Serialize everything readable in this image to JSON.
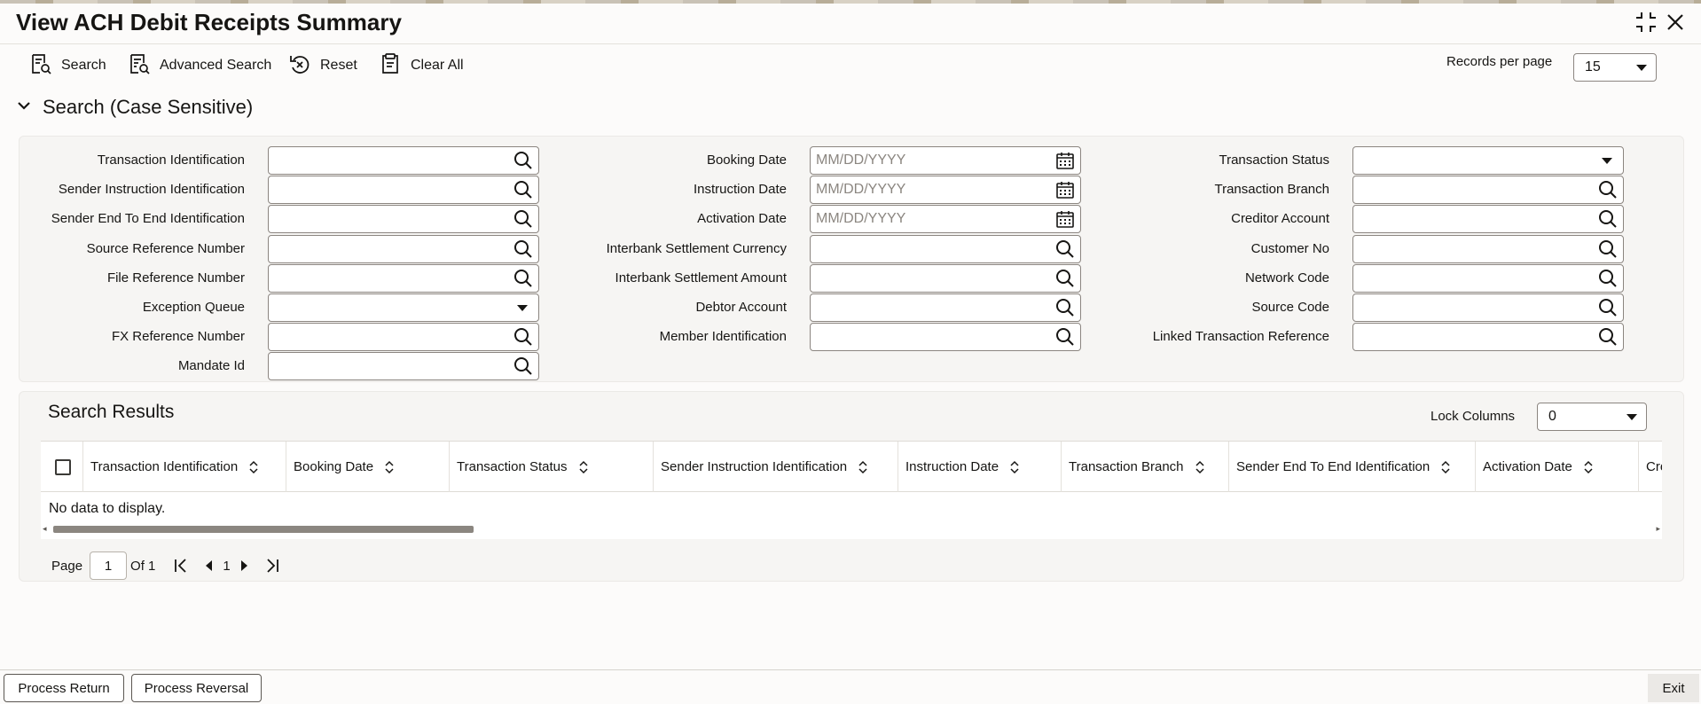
{
  "window": {
    "title": "View ACH Debit Receipts Summary"
  },
  "toolbar": {
    "search_label": "Search",
    "advanced_search_label": "Advanced Search",
    "reset_label": "Reset",
    "clear_all_label": "Clear All",
    "records_per_page_label": "Records per page",
    "records_per_page_value": "15"
  },
  "search_section": {
    "title": "Search (Case Sensitive)",
    "date_placeholder": "MM/DD/YYYY",
    "col1": [
      {
        "label": "Transaction Identification",
        "type": "lookup"
      },
      {
        "label": "Sender Instruction Identification",
        "type": "lookup"
      },
      {
        "label": "Sender End To End Identification",
        "type": "lookup"
      },
      {
        "label": "Source Reference Number",
        "type": "lookup"
      },
      {
        "label": "File Reference Number",
        "type": "lookup"
      },
      {
        "label": "Exception Queue",
        "type": "select"
      },
      {
        "label": "FX Reference Number",
        "type": "lookup"
      },
      {
        "label": "Mandate Id",
        "type": "lookup"
      }
    ],
    "col2": [
      {
        "label": "Booking Date",
        "type": "date"
      },
      {
        "label": "Instruction Date",
        "type": "date"
      },
      {
        "label": "Activation Date",
        "type": "date"
      },
      {
        "label": "Interbank Settlement Currency",
        "type": "lookup"
      },
      {
        "label": "Interbank Settlement Amount",
        "type": "lookup"
      },
      {
        "label": "Debtor Account",
        "type": "lookup"
      },
      {
        "label": "Member Identification",
        "type": "lookup"
      }
    ],
    "col3": [
      {
        "label": "Transaction Status",
        "type": "select"
      },
      {
        "label": "Transaction Branch",
        "type": "lookup"
      },
      {
        "label": "Creditor Account",
        "type": "lookup"
      },
      {
        "label": "Customer No",
        "type": "lookup"
      },
      {
        "label": "Network Code",
        "type": "lookup"
      },
      {
        "label": "Source Code",
        "type": "lookup"
      },
      {
        "label": "Linked Transaction Reference",
        "type": "lookup"
      }
    ]
  },
  "results": {
    "title": "Search Results",
    "lock_columns_label": "Lock Columns",
    "lock_columns_value": "0",
    "columns": [
      "Transaction Identification",
      "Booking Date",
      "Transaction Status",
      "Sender Instruction Identification",
      "Instruction Date",
      "Transaction Branch",
      "Sender End To End Identification",
      "Activation Date",
      "Creditor A"
    ],
    "empty_message": "No data to display."
  },
  "pager": {
    "page_label": "Page",
    "page_value": "1",
    "of_label": "Of 1",
    "current": "1"
  },
  "footer": {
    "process_return_label": "Process Return",
    "process_reversal_label": "Process Reversal",
    "exit_label": "Exit"
  }
}
